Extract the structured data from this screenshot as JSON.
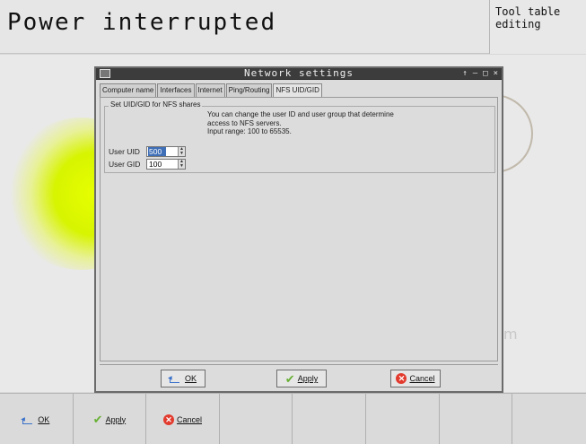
{
  "header": {
    "title": "Power interrupted",
    "mode": "Tool table\nediting"
  },
  "background": {
    "fragment": "m"
  },
  "dialog": {
    "title": "Network settings",
    "controls": [
      "↑",
      "–",
      "□",
      "×"
    ],
    "tabs": [
      {
        "label": "Computer name",
        "active": false
      },
      {
        "label": "Interfaces",
        "active": false
      },
      {
        "label": "Internet",
        "active": false
      },
      {
        "label": "Ping/Routing",
        "active": false
      },
      {
        "label": "NFS UID/GID",
        "active": true
      }
    ],
    "group": {
      "label": "Set UID/GID for NFS shares",
      "info_lines": [
        "You can change the user ID and user group that determine",
        "access to NFS servers.",
        "Input range: 100 to 65535."
      ],
      "uid": {
        "label": "User UID",
        "value": "500"
      },
      "gid": {
        "label": "User GID",
        "value": "100"
      }
    },
    "buttons": {
      "ok": "OK",
      "apply": "Apply",
      "cancel": "Cancel"
    }
  },
  "softkeys": {
    "ok": "OK",
    "apply": "Apply",
    "cancel": "Cancel"
  },
  "colors": {
    "highlight": "#3f6fb7",
    "accent_yellow": "#e7ff00",
    "cancel_red": "#e23b2e",
    "apply_green": "#66b033"
  }
}
